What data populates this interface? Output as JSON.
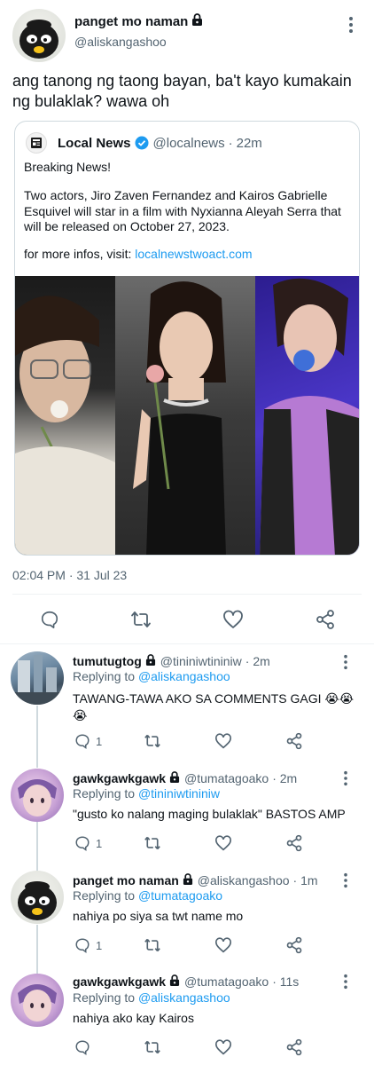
{
  "tweet": {
    "display_name": "panget mo naman",
    "handle": "@aliskangashoo",
    "text": "ang tanong ng taong bayan, ba't kayo kumakain ng bulaklak? wawa oh",
    "timestamp": "02:04 PM · 31 Jul 23"
  },
  "quote": {
    "display_name": "Local News",
    "handle": "@localnews",
    "time": "22m",
    "line1": "Breaking News!",
    "line2": "Two actors, Jiro Zaven Fernandez and Kairos Gabrielle Esquivel will star in a film with Nyxianna Aleyah Serra that will be released on October 27, 2023.",
    "link_prefix": "for more infos, visit: ",
    "link": "localnewstwoact.com"
  },
  "replies": [
    {
      "display_name": "tumutugtog",
      "handle": "@tininiwtininiw",
      "time": "· 2m",
      "replying_label": "Replying to ",
      "replying_to": "@aliskangashoo",
      "text": "TAWANG-TAWA AKO SA COMMENTS GAGI 😭😭😭",
      "reply_count": "1"
    },
    {
      "display_name": "gawkgawkgawk",
      "handle": "@tumatagoako",
      "time": "· 2m",
      "replying_label": "Replying to ",
      "replying_to": "@tininiwtininiw",
      "text": "\"gusto ko nalang maging bulaklak\" BASTOS AMP",
      "reply_count": "1"
    },
    {
      "display_name": "panget mo naman",
      "handle": "@aliskangashoo",
      "time": "· 1m",
      "replying_label": "Replying to ",
      "replying_to": "@tumatagoako",
      "text": "nahiya po siya sa twt name mo",
      "reply_count": "1"
    },
    {
      "display_name": "gawkgawkgawk",
      "handle": "@tumatagoako",
      "time": "· 11s",
      "replying_label": "Replying to ",
      "replying_to": "@aliskangashoo",
      "text": "nahiya ako kay Kairos",
      "reply_count": ""
    }
  ],
  "colors": {
    "accent": "#1d9bf0",
    "text": "#0f1419",
    "secondary": "#536471",
    "border": "#cfd9de"
  },
  "icons": [
    "lock-icon",
    "more-vertical-icon",
    "newspaper-icon",
    "verified-badge-icon",
    "reply-icon",
    "retweet-icon",
    "like-icon",
    "share-icon"
  ]
}
